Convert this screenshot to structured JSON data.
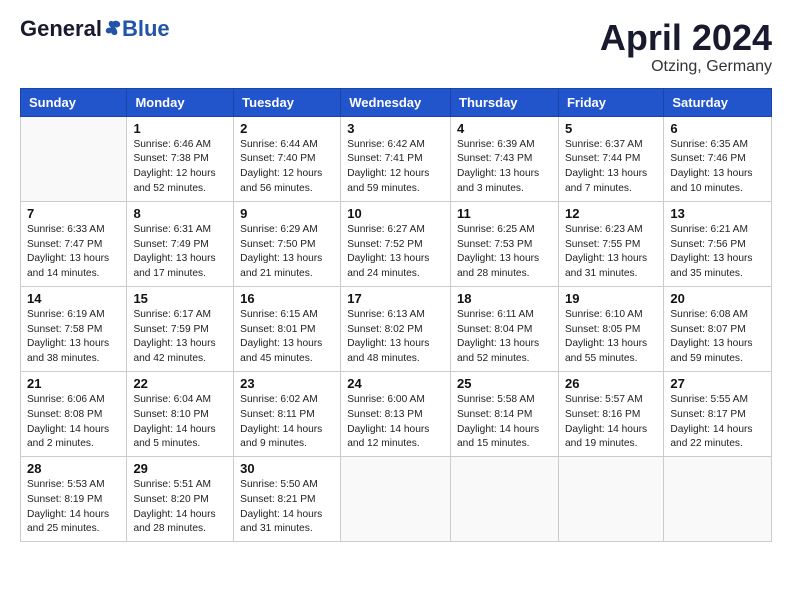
{
  "header": {
    "logo_general": "General",
    "logo_blue": "Blue",
    "month_title": "April 2024",
    "location": "Otzing, Germany"
  },
  "columns": [
    "Sunday",
    "Monday",
    "Tuesday",
    "Wednesday",
    "Thursday",
    "Friday",
    "Saturday"
  ],
  "weeks": [
    [
      {
        "day": "",
        "info": ""
      },
      {
        "day": "1",
        "info": "Sunrise: 6:46 AM\nSunset: 7:38 PM\nDaylight: 12 hours\nand 52 minutes."
      },
      {
        "day": "2",
        "info": "Sunrise: 6:44 AM\nSunset: 7:40 PM\nDaylight: 12 hours\nand 56 minutes."
      },
      {
        "day": "3",
        "info": "Sunrise: 6:42 AM\nSunset: 7:41 PM\nDaylight: 12 hours\nand 59 minutes."
      },
      {
        "day": "4",
        "info": "Sunrise: 6:39 AM\nSunset: 7:43 PM\nDaylight: 13 hours\nand 3 minutes."
      },
      {
        "day": "5",
        "info": "Sunrise: 6:37 AM\nSunset: 7:44 PM\nDaylight: 13 hours\nand 7 minutes."
      },
      {
        "day": "6",
        "info": "Sunrise: 6:35 AM\nSunset: 7:46 PM\nDaylight: 13 hours\nand 10 minutes."
      }
    ],
    [
      {
        "day": "7",
        "info": "Sunrise: 6:33 AM\nSunset: 7:47 PM\nDaylight: 13 hours\nand 14 minutes."
      },
      {
        "day": "8",
        "info": "Sunrise: 6:31 AM\nSunset: 7:49 PM\nDaylight: 13 hours\nand 17 minutes."
      },
      {
        "day": "9",
        "info": "Sunrise: 6:29 AM\nSunset: 7:50 PM\nDaylight: 13 hours\nand 21 minutes."
      },
      {
        "day": "10",
        "info": "Sunrise: 6:27 AM\nSunset: 7:52 PM\nDaylight: 13 hours\nand 24 minutes."
      },
      {
        "day": "11",
        "info": "Sunrise: 6:25 AM\nSunset: 7:53 PM\nDaylight: 13 hours\nand 28 minutes."
      },
      {
        "day": "12",
        "info": "Sunrise: 6:23 AM\nSunset: 7:55 PM\nDaylight: 13 hours\nand 31 minutes."
      },
      {
        "day": "13",
        "info": "Sunrise: 6:21 AM\nSunset: 7:56 PM\nDaylight: 13 hours\nand 35 minutes."
      }
    ],
    [
      {
        "day": "14",
        "info": "Sunrise: 6:19 AM\nSunset: 7:58 PM\nDaylight: 13 hours\nand 38 minutes."
      },
      {
        "day": "15",
        "info": "Sunrise: 6:17 AM\nSunset: 7:59 PM\nDaylight: 13 hours\nand 42 minutes."
      },
      {
        "day": "16",
        "info": "Sunrise: 6:15 AM\nSunset: 8:01 PM\nDaylight: 13 hours\nand 45 minutes."
      },
      {
        "day": "17",
        "info": "Sunrise: 6:13 AM\nSunset: 8:02 PM\nDaylight: 13 hours\nand 48 minutes."
      },
      {
        "day": "18",
        "info": "Sunrise: 6:11 AM\nSunset: 8:04 PM\nDaylight: 13 hours\nand 52 minutes."
      },
      {
        "day": "19",
        "info": "Sunrise: 6:10 AM\nSunset: 8:05 PM\nDaylight: 13 hours\nand 55 minutes."
      },
      {
        "day": "20",
        "info": "Sunrise: 6:08 AM\nSunset: 8:07 PM\nDaylight: 13 hours\nand 59 minutes."
      }
    ],
    [
      {
        "day": "21",
        "info": "Sunrise: 6:06 AM\nSunset: 8:08 PM\nDaylight: 14 hours\nand 2 minutes."
      },
      {
        "day": "22",
        "info": "Sunrise: 6:04 AM\nSunset: 8:10 PM\nDaylight: 14 hours\nand 5 minutes."
      },
      {
        "day": "23",
        "info": "Sunrise: 6:02 AM\nSunset: 8:11 PM\nDaylight: 14 hours\nand 9 minutes."
      },
      {
        "day": "24",
        "info": "Sunrise: 6:00 AM\nSunset: 8:13 PM\nDaylight: 14 hours\nand 12 minutes."
      },
      {
        "day": "25",
        "info": "Sunrise: 5:58 AM\nSunset: 8:14 PM\nDaylight: 14 hours\nand 15 minutes."
      },
      {
        "day": "26",
        "info": "Sunrise: 5:57 AM\nSunset: 8:16 PM\nDaylight: 14 hours\nand 19 minutes."
      },
      {
        "day": "27",
        "info": "Sunrise: 5:55 AM\nSunset: 8:17 PM\nDaylight: 14 hours\nand 22 minutes."
      }
    ],
    [
      {
        "day": "28",
        "info": "Sunrise: 5:53 AM\nSunset: 8:19 PM\nDaylight: 14 hours\nand 25 minutes."
      },
      {
        "day": "29",
        "info": "Sunrise: 5:51 AM\nSunset: 8:20 PM\nDaylight: 14 hours\nand 28 minutes."
      },
      {
        "day": "30",
        "info": "Sunrise: 5:50 AM\nSunset: 8:21 PM\nDaylight: 14 hours\nand 31 minutes."
      },
      {
        "day": "",
        "info": ""
      },
      {
        "day": "",
        "info": ""
      },
      {
        "day": "",
        "info": ""
      },
      {
        "day": "",
        "info": ""
      }
    ]
  ]
}
